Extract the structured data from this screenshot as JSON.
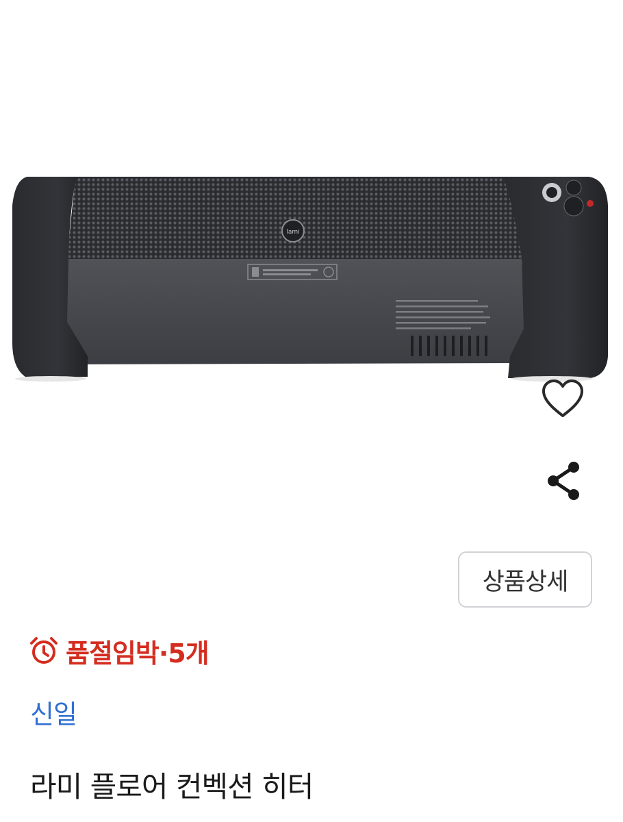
{
  "product": {
    "image_icon": "heater-product-photo",
    "stock_notice": "품절임박·5개",
    "stock_icon": "alarm-clock-icon",
    "brand": "신일",
    "title": "라미 플로어 컨벡션 히터",
    "image_branding": "lami"
  },
  "actions": {
    "wishlist_icon": "heart-icon",
    "share_icon": "share-icon",
    "detail_button_label": "상품상세"
  },
  "colors": {
    "stock_accent": "#d42d20",
    "brand_link": "#2f6fd4",
    "button_border": "#d2d2d6"
  }
}
